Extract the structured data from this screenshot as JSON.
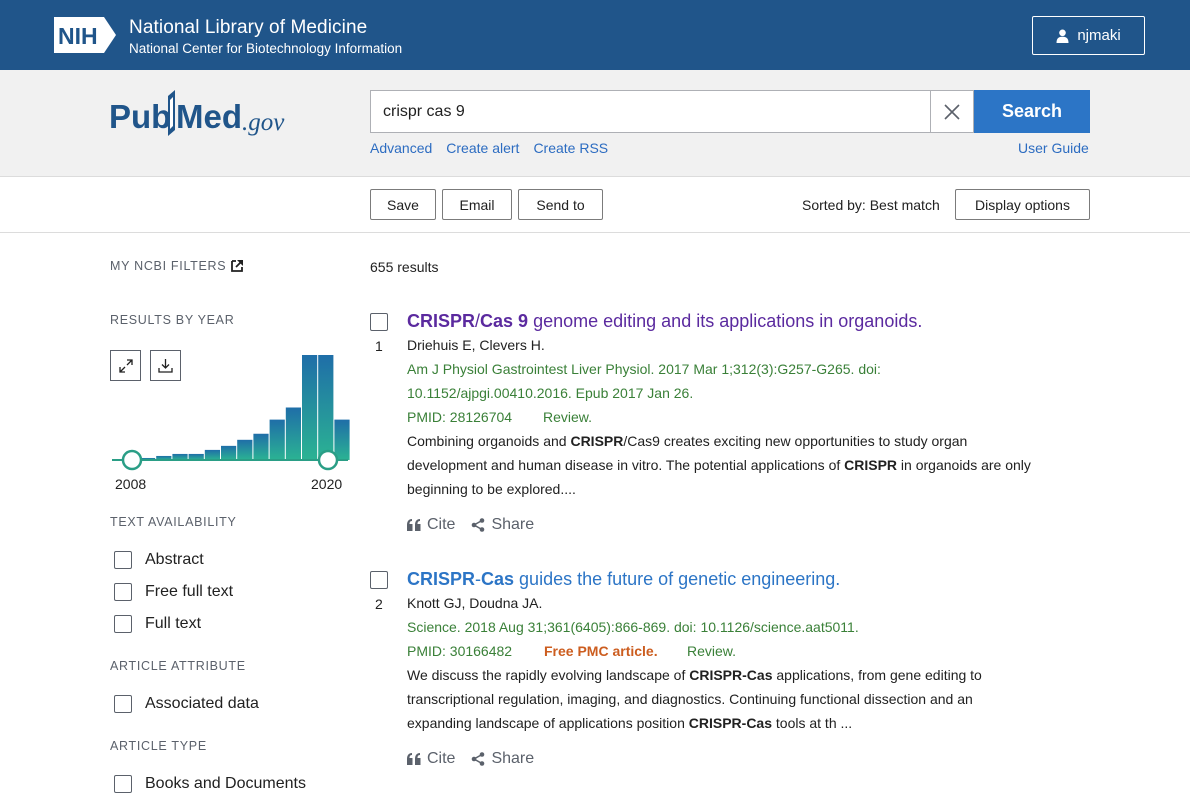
{
  "header": {
    "nih_logo_text": "NIH",
    "title": "National Library of Medicine",
    "subtitle": "National Center for Biotechnology Information",
    "user_name": "njmaki"
  },
  "search": {
    "logo_text": "PubMed.gov",
    "query": "crispr cas 9",
    "button_label": "Search",
    "links": [
      "Advanced",
      "Create alert",
      "Create RSS"
    ],
    "user_guide": "User Guide"
  },
  "toolbar": {
    "save": "Save",
    "email": "Email",
    "send_to": "Send to",
    "sorted_by": "Sorted by: Best match",
    "display_options": "Display options"
  },
  "sidebar": {
    "my_filters": "MY NCBI FILTERS",
    "results_by_year": "RESULTS BY YEAR",
    "year_start": "2008",
    "year_end": "2020",
    "histogram_values": [
      1,
      2,
      3,
      3,
      5,
      7,
      10,
      13,
      20,
      26,
      52,
      52,
      20
    ],
    "text_availability": "TEXT AVAILABILITY",
    "text_filters": [
      "Abstract",
      "Free full text",
      "Full text"
    ],
    "article_attribute": "ARTICLE ATTRIBUTE",
    "attribute_filters": [
      "Associated data"
    ],
    "article_type": "ARTICLE TYPE",
    "type_filters": [
      "Books and Documents"
    ]
  },
  "results": {
    "count": "655 results",
    "items": [
      {
        "num": "1",
        "title_a": "CRISPR",
        "title_b": "/",
        "title_c": "Cas 9",
        "title_d": " genome editing and its applications in organoids.",
        "authors": "Driehuis E, Clevers H.",
        "citation_1": "Am J Physiol Gastrointest Liver Physiol. 2017 Mar 1;312(3):G257-G265. doi:",
        "citation_2": "10.1152/ajpgi.00410.2016. Epub 2017 Jan 26.",
        "pmid": "PMID: 28126704",
        "tag": "Review.",
        "snip1_a": "Combining organoids and ",
        "snip1_b": "CRISPR",
        "snip1_c": "/Cas9 creates exciting new opportunities to study organ",
        "snip2_a": "development and human disease in vitro. The potential applications of ",
        "snip2_b": "CRISPR",
        "snip2_c": " in organoids are only",
        "snip3": "beginning to be explored....",
        "cite": "Cite",
        "share": "Share"
      },
      {
        "num": "2",
        "title_a": "CRISPR",
        "title_b": "-",
        "title_c": "Cas",
        "title_d": " guides the future of genetic engineering.",
        "authors": "Knott GJ, Doudna JA.",
        "citation_1": "Science. 2018 Aug 31;361(6405):866-869. doi: 10.1126/science.aat5011.",
        "pmid": "PMID: 30166482",
        "free_pmc": "Free PMC article.",
        "tag": "Review.",
        "snip1_a": "We discuss the rapidly evolving landscape of ",
        "snip1_b": "CRISPR-Cas",
        "snip1_c": " applications, from gene editing to",
        "snip2": "transcriptional regulation, imaging, and diagnostics. Continuing functional dissection and an",
        "snip3_a": "expanding landscape of applications position ",
        "snip3_b": "CRISPR-Cas",
        "snip3_c": " tools at th ...",
        "cite": "Cite",
        "share": "Share"
      }
    ]
  }
}
